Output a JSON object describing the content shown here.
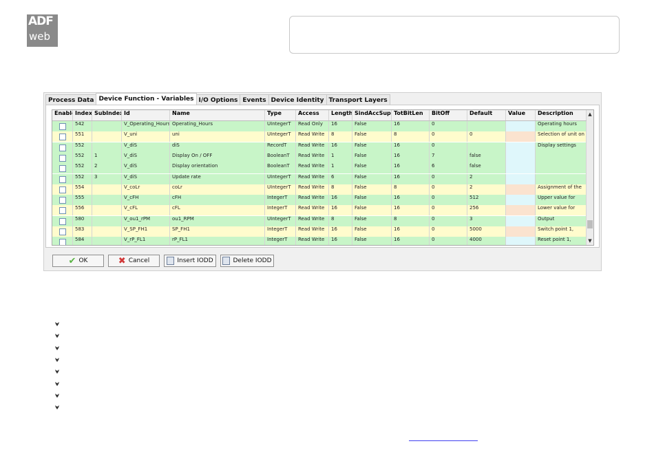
{
  "logo": {
    "line1": "ADF",
    "line2": "web"
  },
  "tabs": [
    "Process Data",
    "Device Function - Variables",
    "I/O Options",
    "Events",
    "Device Identity",
    "Transport Layers"
  ],
  "active_tab": "Device Function - Variables",
  "table": {
    "headers": [
      "Enable",
      "Index",
      "SubIndex",
      "Id",
      "Name",
      "Type",
      "Access",
      "Length",
      "SindAccSupp",
      "TotBitLen",
      "BitOff",
      "Default",
      "Value",
      "Description"
    ],
    "rows": [
      {
        "index": "542",
        "subindex": "",
        "id": "V_Operating_Hours",
        "name": "Operating_Hours",
        "type": "UIntegerT",
        "access": "Read Only",
        "length": "16",
        "sind": "False",
        "totbit": "16",
        "bitoff": "0",
        "default": "",
        "value": "",
        "description": "Operating hours"
      },
      {
        "index": "551",
        "subindex": "",
        "id": "V_uni",
        "name": "uni",
        "type": "UIntegerT",
        "access": "Read Write",
        "length": "8",
        "sind": "False",
        "totbit": "8",
        "bitoff": "0",
        "default": "0",
        "value": "",
        "description": "Selection of unit on"
      },
      {
        "index": "552",
        "subindex": "",
        "id": "V_diS",
        "name": "diS",
        "type": "RecordT",
        "access": "Read Write",
        "length": "16",
        "sind": "False",
        "totbit": "16",
        "bitoff": "0",
        "default": "",
        "value": "",
        "description": "Display settings"
      },
      {
        "index": "552",
        "subindex": "1",
        "id": "V_diS",
        "name": "Display On / OFF",
        "type": "BooleanT",
        "access": "Read Write",
        "length": "1",
        "sind": "False",
        "totbit": "16",
        "bitoff": "7",
        "default": "false",
        "value": "",
        "description": ""
      },
      {
        "index": "552",
        "subindex": "2",
        "id": "V_diS",
        "name": "Display orientation",
        "type": "BooleanT",
        "access": "Read Write",
        "length": "1",
        "sind": "False",
        "totbit": "16",
        "bitoff": "6",
        "default": "false",
        "value": "",
        "description": ""
      },
      {
        "index": "552",
        "subindex": "3",
        "id": "V_diS",
        "name": "Update rate",
        "type": "UIntegerT",
        "access": "Read Write",
        "length": "6",
        "sind": "False",
        "totbit": "16",
        "bitoff": "0",
        "default": "2",
        "value": "",
        "description": ""
      },
      {
        "index": "554",
        "subindex": "",
        "id": "V_coLr",
        "name": "coLr",
        "type": "UIntegerT",
        "access": "Read Write",
        "length": "8",
        "sind": "False",
        "totbit": "8",
        "bitoff": "0",
        "default": "2",
        "value": "",
        "description": "Assignment of the"
      },
      {
        "index": "555",
        "subindex": "",
        "id": "V_cFH",
        "name": "cFH",
        "type": "IntegerT",
        "access": "Read Write",
        "length": "16",
        "sind": "False",
        "totbit": "16",
        "bitoff": "0",
        "default": "512",
        "value": "",
        "description": "Upper value for"
      },
      {
        "index": "556",
        "subindex": "",
        "id": "V_cFL",
        "name": "cFL",
        "type": "IntegerT",
        "access": "Read Write",
        "length": "16",
        "sind": "False",
        "totbit": "16",
        "bitoff": "0",
        "default": "256",
        "value": "",
        "description": "Lower value for"
      },
      {
        "index": "580",
        "subindex": "",
        "id": "V_ou1_rPM",
        "name": "ou1_RPM",
        "type": "UIntegerT",
        "access": "Read Write",
        "length": "8",
        "sind": "False",
        "totbit": "8",
        "bitoff": "0",
        "default": "3",
        "value": "",
        "description": "Output"
      },
      {
        "index": "583",
        "subindex": "",
        "id": "V_SP_FH1",
        "name": "SP_FH1",
        "type": "IntegerT",
        "access": "Read Write",
        "length": "16",
        "sind": "False",
        "totbit": "16",
        "bitoff": "0",
        "default": "5000",
        "value": "",
        "description": "Switch point 1,"
      },
      {
        "index": "584",
        "subindex": "",
        "id": "V_rP_FL1",
        "name": "rP_FL1",
        "type": "IntegerT",
        "access": "Read Write",
        "length": "16",
        "sind": "False",
        "totbit": "16",
        "bitoff": "0",
        "default": "4000",
        "value": "",
        "description": "Reset point 1,"
      }
    ],
    "row_colors": [
      "green",
      "yellow",
      "green",
      "green",
      "green",
      "green",
      "yellow",
      "green",
      "yellow",
      "green",
      "yellow",
      "green"
    ]
  },
  "buttons": {
    "ok": "OK",
    "cancel": "Cancel",
    "insert": "Insert IODD",
    "delete": "Delete IODD"
  },
  "colors": {
    "row_green": "#c8f5c8",
    "row_yellow": "#fffccd",
    "value_cyan": "#dff7fb",
    "value_peach": "#fbe3cf",
    "logo_gray": "#8a8a8a",
    "link_blue": "#3f3ff0"
  },
  "icons": {
    "ok": "check-icon",
    "cancel": "cross-icon",
    "insert": "insert-iodd-icon",
    "delete": "delete-iodd-icon",
    "bullet": "bullet-arrow-icon"
  }
}
